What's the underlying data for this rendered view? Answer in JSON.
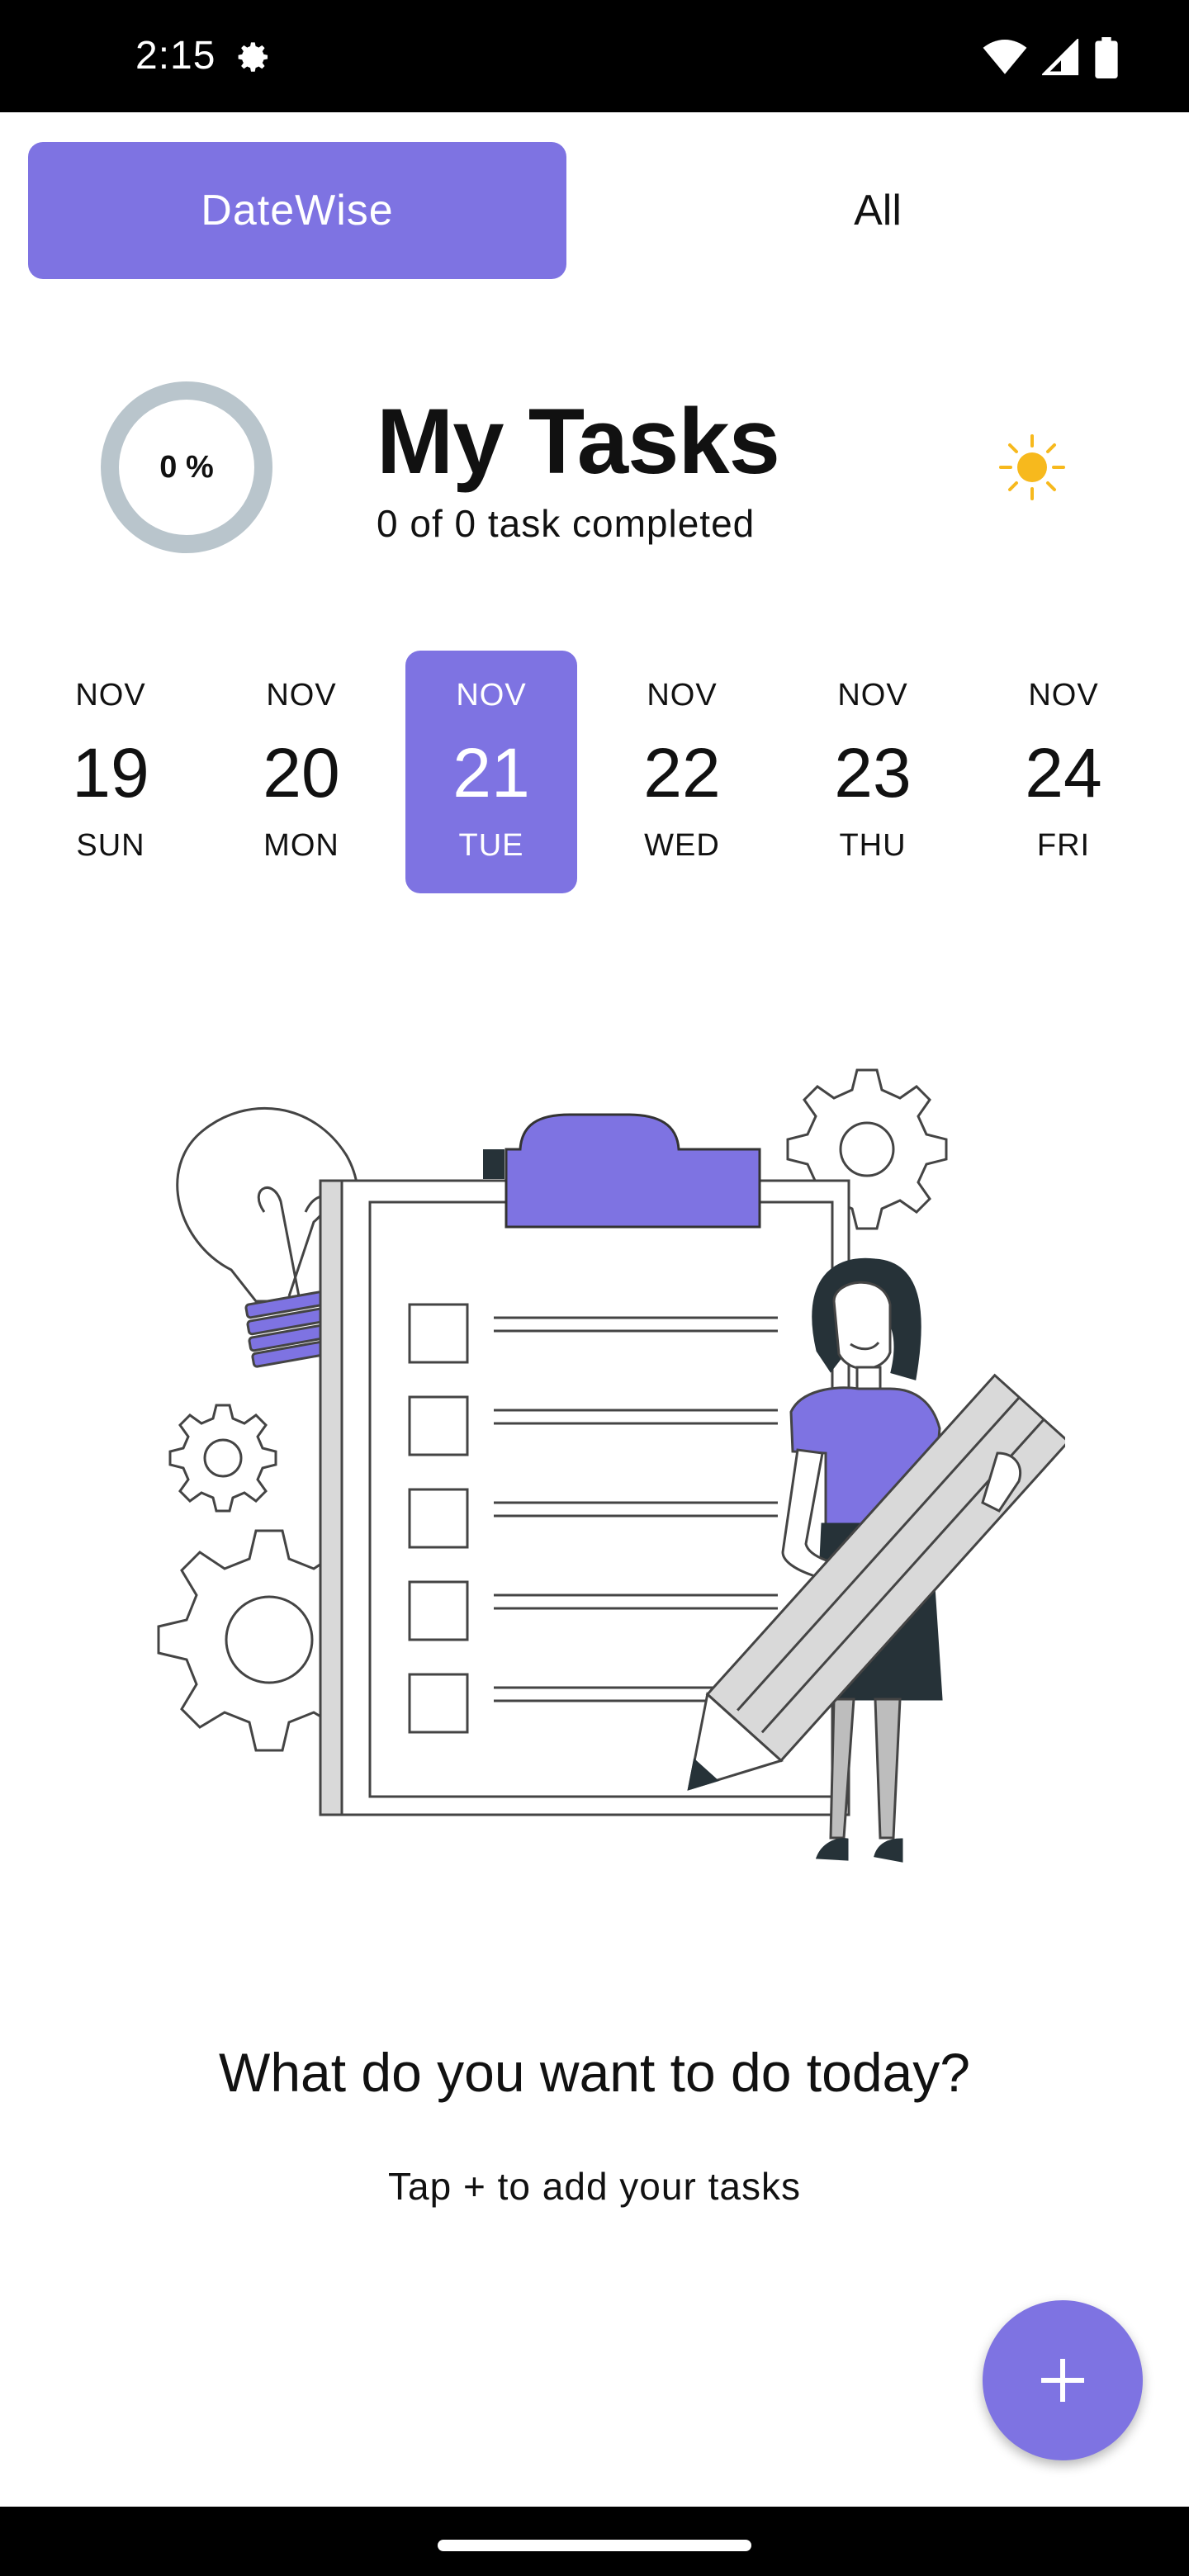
{
  "status_bar": {
    "time": "2:15",
    "icons": [
      "settings-gear-icon",
      "wifi-icon",
      "cell-signal-icon",
      "battery-icon"
    ]
  },
  "tabs": {
    "items": [
      {
        "label": "DateWise",
        "active": true
      },
      {
        "label": "All",
        "active": false
      }
    ]
  },
  "header": {
    "progress_label": "0 %",
    "progress_value": 0,
    "title": "My Tasks",
    "subtitle": "0 of 0 task completed",
    "theme_icon": "sun-icon"
  },
  "dates": [
    {
      "month": "NOV",
      "day": "19",
      "weekday": "SUN",
      "selected": false
    },
    {
      "month": "NOV",
      "day": "20",
      "weekday": "MON",
      "selected": false
    },
    {
      "month": "NOV",
      "day": "21",
      "weekday": "TUE",
      "selected": true
    },
    {
      "month": "NOV",
      "day": "22",
      "weekday": "WED",
      "selected": false
    },
    {
      "month": "NOV",
      "day": "23",
      "weekday": "THU",
      "selected": false
    },
    {
      "month": "NOV",
      "day": "24",
      "weekday": "FRI",
      "selected": false
    }
  ],
  "empty_state": {
    "title": "What do you want to do today?",
    "subtitle": "Tap + to add your tasks"
  },
  "fab": {
    "icon": "plus-icon"
  },
  "colors": {
    "accent": "#7e73e2",
    "ring_track": "#b9c5cc",
    "sun": "#f7b91d",
    "status_bar": "#000000"
  }
}
